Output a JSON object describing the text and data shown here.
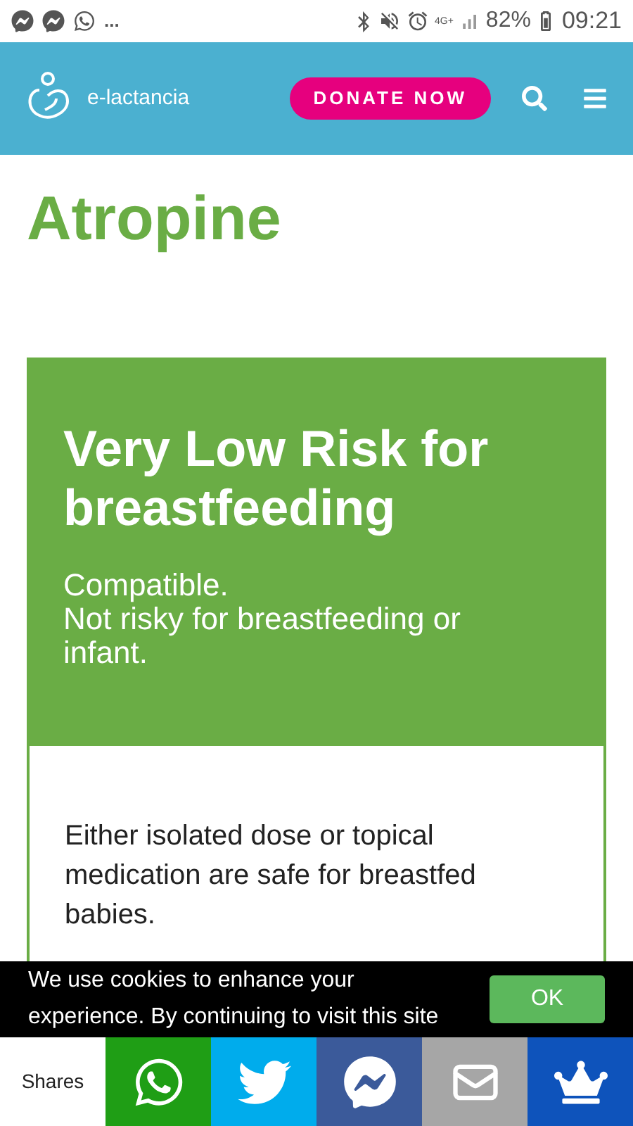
{
  "status_bar": {
    "notifications": [
      {
        "kind": "messenger"
      },
      {
        "kind": "messenger"
      },
      {
        "kind": "whatsapp"
      }
    ],
    "more": "...",
    "network": "4G+",
    "battery": "82%",
    "time": "09:21"
  },
  "header": {
    "logo_text": "e-lactancia",
    "donate": "DONATE NOW"
  },
  "title": "Atropine",
  "risk_card": {
    "heading": "Very Low Risk for breastfeeding",
    "summary": [
      "Compatible.",
      "Not risky for breastfeeding or infant."
    ],
    "body": "Either isolated dose or topical medication are safe for breastfed babies."
  },
  "cookie_bar": {
    "text": "We use cookies to enhance your experience. By continuing to visit this site",
    "button": "OK"
  },
  "share_bar": {
    "label": "Shares",
    "buttons": [
      {
        "kind": "whatsapp",
        "color": "#1f9e15"
      },
      {
        "kind": "twitter",
        "color": "#00acec"
      },
      {
        "kind": "messenger",
        "color": "#3b5a9a"
      },
      {
        "kind": "email",
        "color": "#a6a6a6"
      },
      {
        "kind": "crown",
        "color": "#0e53bb"
      }
    ]
  }
}
